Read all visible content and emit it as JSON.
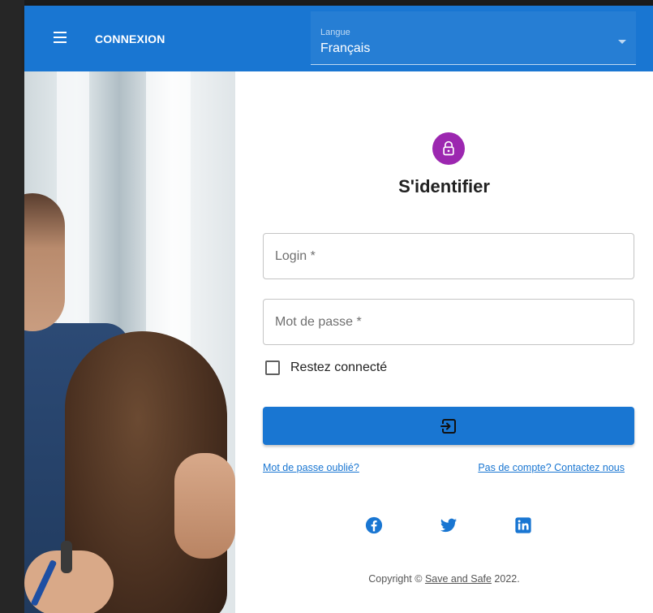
{
  "appbar": {
    "title": "CONNEXION",
    "language_label": "Langue",
    "language_value": "Français"
  },
  "form": {
    "title": "S'identifier",
    "login_placeholder": "Login *",
    "password_placeholder": "Mot de passe *",
    "remember_label": "Restez connecté",
    "submit_icon": "login-icon"
  },
  "links": {
    "forgot_password": "Mot de passe oublié?",
    "contact": "Pas de compte? Contactez nous"
  },
  "socials": [
    "facebook-icon",
    "twitter-icon",
    "linkedin-icon"
  ],
  "footer": {
    "prefix": "Copyright © ",
    "company": "Save and Safe",
    "suffix": " 2022."
  },
  "colors": {
    "primary": "#1976d2",
    "avatar": "#9c27b0"
  }
}
